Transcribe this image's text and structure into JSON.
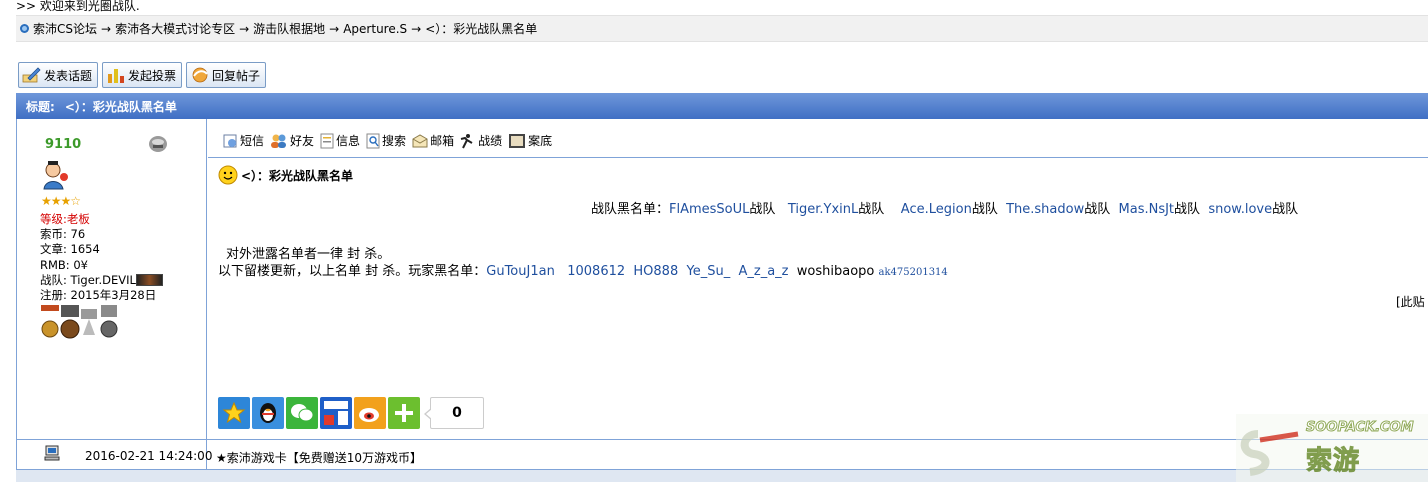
{
  "welcome": ">> 欢迎来到光圈战队.",
  "breadcrumb": {
    "items": [
      "索沛CS论坛",
      "索沛各大模式讨论专区",
      "游击队根据地",
      "Aperture.S",
      "<）：彩光战队黑名单"
    ],
    "separator": "→"
  },
  "actions": {
    "new_topic": "发表话题",
    "new_poll": "发起投票",
    "reply": "回复帖子"
  },
  "thread": {
    "title_label": "标题:",
    "title": "<）：彩光战队黑名单"
  },
  "author": {
    "name": "9110",
    "stars": "★★★☆",
    "rank_label": "等级:",
    "rank": "老板",
    "coins": "索币: 76",
    "posts": "文章: 1654",
    "rmb": "RMB: 0¥",
    "clan": "战队: Tiger.DEVIL",
    "registered": "注册: 2015年3月28日"
  },
  "post_toolbar": {
    "message": "短信",
    "friend": "好友",
    "info": "信息",
    "search": "搜索",
    "mail": "邮箱",
    "record": "战绩",
    "archive": "案底"
  },
  "post": {
    "title": "<）：彩光战队黑名单",
    "team_blacklist_label": "战队黑名单：",
    "teams": [
      {
        "name": "FlAmesSoUL",
        "suffix": "战队"
      },
      {
        "name": "Tiger.YxinL",
        "suffix": "战队"
      },
      {
        "name": "Ace.Legion",
        "suffix": "战队"
      },
      {
        "name": "The.shadow",
        "suffix": "战队"
      },
      {
        "name": "Mas.NsJt",
        "suffix": "战队"
      },
      {
        "name": "snow.love",
        "suffix": "战队"
      }
    ],
    "notice_line": "对外泄露名单者一律 封 杀。",
    "players_prefix": "以下留楼更新，以上名单 封 杀。玩家黑名单：",
    "players": [
      "GuTouJ1an",
      "1008612",
      "HO888",
      "Ye_Su_",
      "A_z_a_z"
    ],
    "player_plain": "woshibaopo",
    "player_small": "ak475201314",
    "truncated_text": "[此贴",
    "share_count": "0"
  },
  "footer": {
    "datetime": "2016-02-21 14:24:00",
    "ad": "★索沛游戏卡【免费赠送10万游戏币】"
  },
  "watermark": {
    "top": "SOOPACK.COM",
    "main": "索游"
  },
  "colors": {
    "titlebar": "#4a78c9",
    "link": "#1f4f9e",
    "username": "#3c9a2a",
    "rank": "#d40000",
    "border": "#7fa3d8"
  }
}
